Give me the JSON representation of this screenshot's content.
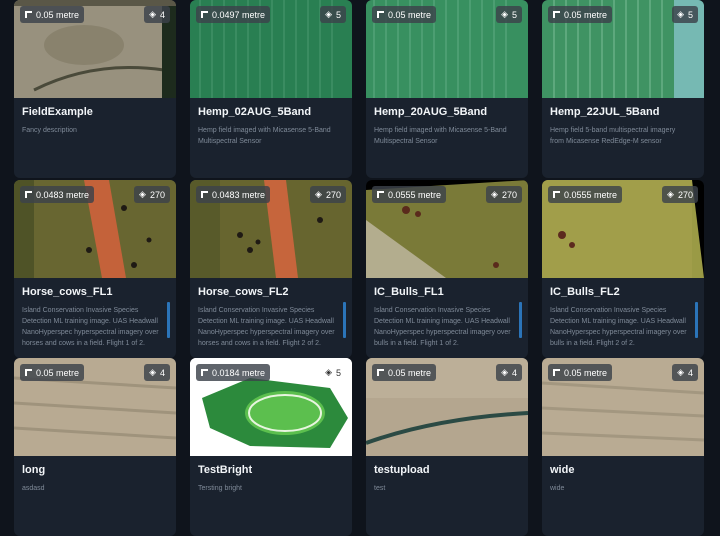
{
  "icons": {
    "resolution": "resolution-corner-icon",
    "bands": "layers-icon"
  },
  "colors": {
    "background": "#0f141c",
    "card": "#1a222e",
    "badge": "#3c424a",
    "scroll_accent": "#2b74b8"
  },
  "datasets": [
    {
      "title": "FieldExample",
      "description": "Fancy description",
      "resolution": "0.05 metre",
      "bands": "4"
    },
    {
      "title": "Hemp_02AUG_5Band",
      "description": "Hemp field imaged with Micasense 5-Band Multispectral Sensor",
      "resolution": "0.0497 metre",
      "bands": "5"
    },
    {
      "title": "Hemp_20AUG_5Band",
      "description": "Hemp field imaged with Micasense 5-Band Multispectral Sensor",
      "resolution": "0.05 metre",
      "bands": "5"
    },
    {
      "title": "Hemp_22JUL_5Band",
      "description": "Hemp field 5-band multispectral imagery from Micasense RedEdge-M sensor",
      "resolution": "0.05 metre",
      "bands": "5"
    },
    {
      "title": "Horse_cows_FL1",
      "description": "Island Conservation Invasive Species Detection ML training image. UAS Headwall NanoHyperspec hyperspectral imagery over horses and cows in a field. Flight 1 of 2.",
      "resolution": "0.0483 metre",
      "bands": "270"
    },
    {
      "title": "Horse_cows_FL2",
      "description": "Island Conservation Invasive Species Detection ML training image. UAS Headwall NanoHyperspec hyperspectral imagery over horses and cows in a field. Flight 2 of 2.",
      "resolution": "0.0483 metre",
      "bands": "270"
    },
    {
      "title": "IC_Bulls_FL1",
      "description": "Island Conservation Invasive Species Detection ML training image. UAS Headwall NanoHyperspec hyperspectral imagery over bulls in a field. Flight 1 of 2.",
      "resolution": "0.0555 metre",
      "bands": "270"
    },
    {
      "title": "IC_Bulls_FL2",
      "description": "Island Conservation Invasive Species Detection ML training image. UAS Headwall NanoHyperspec hyperspectral imagery over bulls in a field. Flight 2 of 2.",
      "resolution": "0.0555 metre",
      "bands": "270"
    },
    {
      "title": "long",
      "description": "asdasd",
      "resolution": "0.05 metre",
      "bands": "4"
    },
    {
      "title": "TestBright",
      "description": "Tersting bright",
      "resolution": "0.0184 metre",
      "bands": "5"
    },
    {
      "title": "testupload",
      "description": "test",
      "resolution": "0.05 metre",
      "bands": "4"
    },
    {
      "title": "wide",
      "description": "wide",
      "resolution": "0.05 metre",
      "bands": "4"
    }
  ]
}
